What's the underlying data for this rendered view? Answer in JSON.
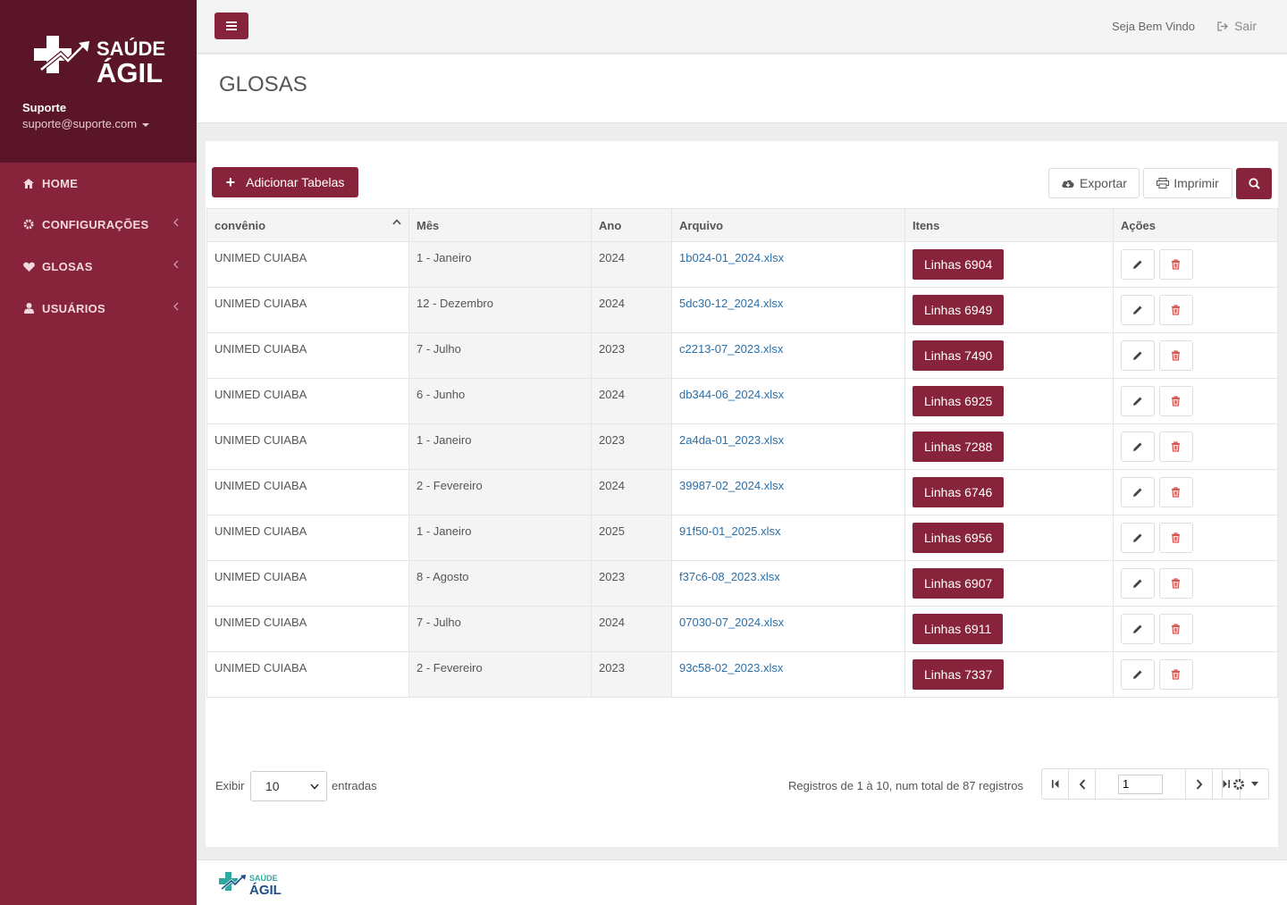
{
  "brand": {
    "logo_line1": "SAÚDE",
    "logo_line2": "ÁGIL"
  },
  "user": {
    "name": "Suporte",
    "email": "suporte@suporte.com"
  },
  "nav": [
    {
      "label": "HOME",
      "icon": "home-icon"
    },
    {
      "label": "CONFIGURAÇÕES",
      "icon": "gear-icon"
    },
    {
      "label": "GLOSAS",
      "icon": "heart-icon"
    },
    {
      "label": "USUÁRIOS",
      "icon": "user-icon"
    }
  ],
  "topbar": {
    "welcome": "Seja Bem Vindo",
    "logout": "Sair"
  },
  "page": {
    "title": "GLOSAS"
  },
  "toolbar": {
    "add_label": "Adicionar Tabelas",
    "export_label": "Exportar",
    "print_label": "Imprimir"
  },
  "table": {
    "columns": [
      "convênio",
      "Mês",
      "Ano",
      "Arquivo",
      "Itens",
      "Ações"
    ],
    "rows": [
      {
        "convenio": "UNIMED CUIABA",
        "mes": "1 - Janeiro",
        "ano": "2024",
        "arquivo": "1b024-01_2024.xlsx",
        "itens": "Linhas 6904"
      },
      {
        "convenio": "UNIMED CUIABA",
        "mes": "12 - Dezembro",
        "ano": "2024",
        "arquivo": "5dc30-12_2024.xlsx",
        "itens": "Linhas 6949"
      },
      {
        "convenio": "UNIMED CUIABA",
        "mes": "7 - Julho",
        "ano": "2023",
        "arquivo": "c2213-07_2023.xlsx",
        "itens": "Linhas 7490"
      },
      {
        "convenio": "UNIMED CUIABA",
        "mes": "6 - Junho",
        "ano": "2024",
        "arquivo": "db344-06_2024.xlsx",
        "itens": "Linhas 6925"
      },
      {
        "convenio": "UNIMED CUIABA",
        "mes": "1 - Janeiro",
        "ano": "2023",
        "arquivo": "2a4da-01_2023.xlsx",
        "itens": "Linhas 7288"
      },
      {
        "convenio": "UNIMED CUIABA",
        "mes": "2 - Fevereiro",
        "ano": "2024",
        "arquivo": "39987-02_2024.xlsx",
        "itens": "Linhas 6746"
      },
      {
        "convenio": "UNIMED CUIABA",
        "mes": "1 - Janeiro",
        "ano": "2025",
        "arquivo": "91f50-01_2025.xlsx",
        "itens": "Linhas 6956"
      },
      {
        "convenio": "UNIMED CUIABA",
        "mes": "8 - Agosto",
        "ano": "2023",
        "arquivo": "f37c6-08_2023.xlsx",
        "itens": "Linhas 6907"
      },
      {
        "convenio": "UNIMED CUIABA",
        "mes": "7 - Julho",
        "ano": "2024",
        "arquivo": "07030-07_2024.xlsx",
        "itens": "Linhas 6911"
      },
      {
        "convenio": "UNIMED CUIABA",
        "mes": "2 - Fevereiro",
        "ano": "2023",
        "arquivo": "93c58-02_2023.xlsx",
        "itens": "Linhas 7337"
      }
    ]
  },
  "pagination": {
    "show_label": "Exibir",
    "page_size": "10",
    "entries_label": "entradas",
    "info": "Registros de 1 à 10, num total de 87 registros",
    "current_page": "1"
  },
  "colors": {
    "brand": "#87243b",
    "brand_dark": "#5a1628",
    "link": "#2a6fa8"
  }
}
